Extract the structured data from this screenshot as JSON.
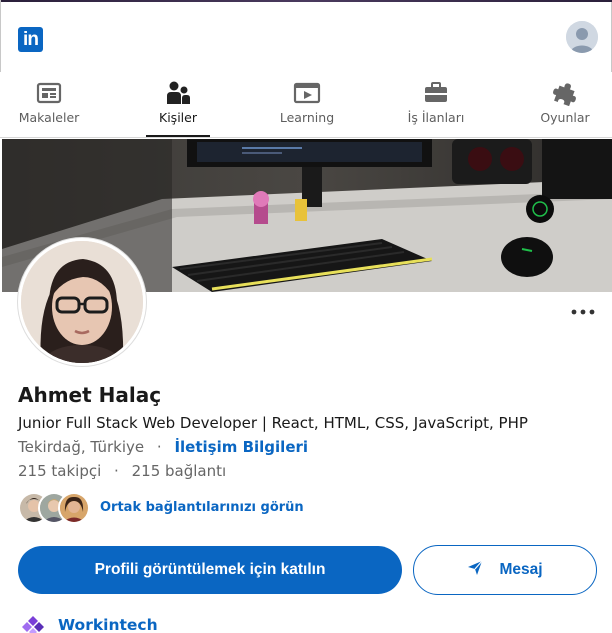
{
  "header": {
    "logo_text": "in",
    "brand_color": "#0a66c2"
  },
  "nav": {
    "items": [
      {
        "label": "Makaleler",
        "icon": "articles-icon"
      },
      {
        "label": "Kişiler",
        "icon": "people-icon",
        "active": true
      },
      {
        "label": "Learning",
        "icon": "learning-icon"
      },
      {
        "label": "İş İlanları",
        "icon": "briefcase-icon"
      },
      {
        "label": "Oyunlar",
        "icon": "puzzle-icon"
      }
    ]
  },
  "profile": {
    "name": "Ahmet Halaç",
    "headline": "Junior Full Stack Web Developer | React, HTML, CSS, JavaScript, PHP",
    "location": "Tekirdağ, Türkiye",
    "separator": "·",
    "contact_info": "İletişim Bilgileri",
    "followers": "215 takipçi",
    "connections": "215 bağlantı",
    "mutual_connections_text": "Ortak bağlantılarınızı görün"
  },
  "actions": {
    "join_label": "Profili görüntülemek için katılın",
    "message_label": "Mesaj"
  },
  "company": {
    "name": "Workintech"
  }
}
